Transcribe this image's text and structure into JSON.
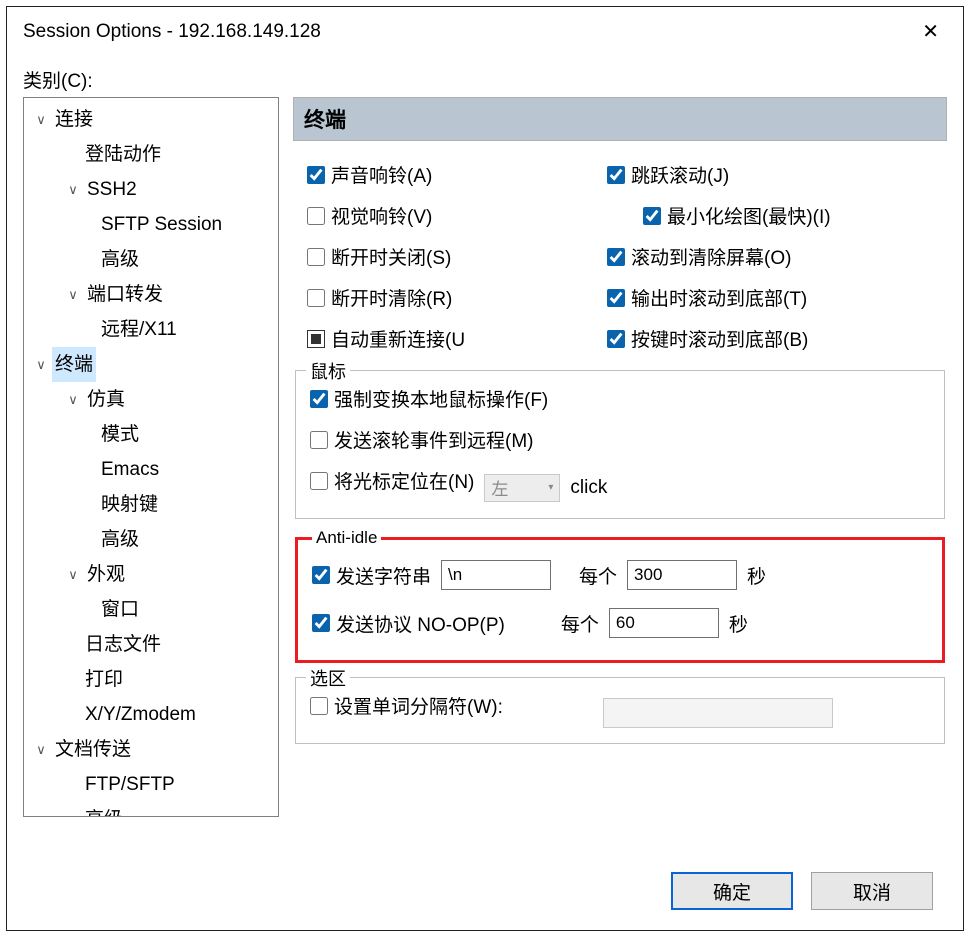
{
  "window": {
    "title": "Session Options - 192.168.149.128"
  },
  "category_label": "类别(C):",
  "tree": {
    "connection": "连接",
    "logon": "登陆动作",
    "ssh2": "SSH2",
    "sftp": "SFTP Session",
    "advanced1": "高级",
    "portfwd": "端口转发",
    "remote": "远程/X11",
    "terminal": "终端",
    "emulation": "仿真",
    "mode": "模式",
    "emacs": "Emacs",
    "mapkey": "映射键",
    "advanced2": "高级",
    "appearance": "外观",
    "window": "窗口",
    "logfile": "日志文件",
    "print": "打印",
    "xyzmodem": "X/Y/Zmodem",
    "filetransfer": "文档传送",
    "ftpsftp": "FTP/SFTP",
    "advanced3": "高级"
  },
  "panel": {
    "header": "终端",
    "checks": {
      "audioBell": "声音响铃(A)",
      "visualBell": "视觉响铃(V)",
      "closeOnDisconnect": "断开时关闭(S)",
      "clearOnDisconnect": "断开时清除(R)",
      "autoReconnect": "自动重新连接(U",
      "jumpScroll": "跳跃滚动(J)",
      "minDraw": "最小化绘图(最快)(I)",
      "scrollClear": "滚动到清除屏幕(O)",
      "scrollBottomOutput": "输出时滚动到底部(T)",
      "scrollBottomKey": "按键时滚动到底部(B)"
    },
    "mouse": {
      "legend": "鼠标",
      "forceLocal": "强制变换本地鼠标操作(F)",
      "sendWheel": "发送滚轮事件到远程(M)",
      "placeCursor": "将光标定位在(N)",
      "leftOption": "左",
      "clickText": "click"
    },
    "antiidle": {
      "legend": "Anti-idle",
      "sendString": "发送字符串",
      "stringValue": "\\n",
      "everyLabel": "每个",
      "stringSeconds": "300",
      "secondsLabel": "秒",
      "sendProtocol": "发送协议 NO-OP(P)",
      "protocolSeconds": "60"
    },
    "selection": {
      "legend": "选区",
      "wordDelim": "设置单词分隔符(W):"
    }
  },
  "buttons": {
    "ok": "确定",
    "cancel": "取消"
  }
}
